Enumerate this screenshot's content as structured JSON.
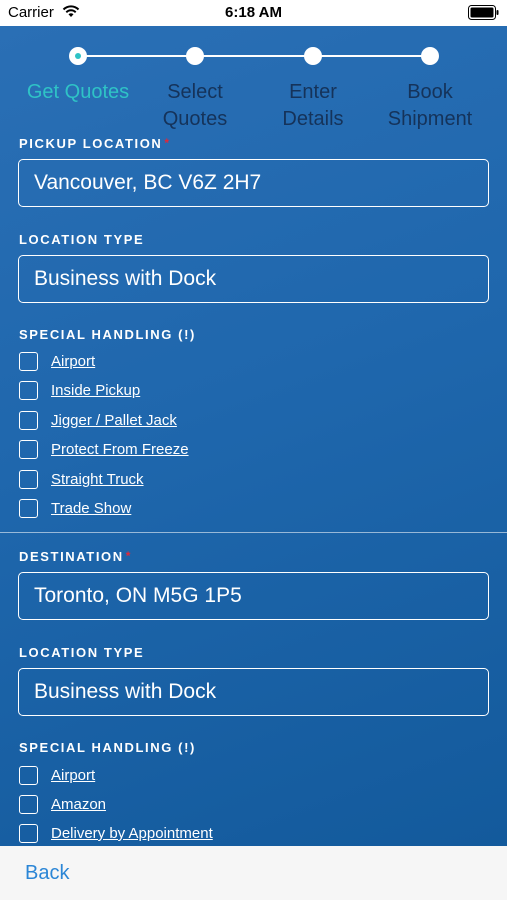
{
  "status_bar": {
    "carrier": "Carrier",
    "time": "6:18 AM"
  },
  "stepper": {
    "steps": [
      {
        "label_line1": "Get Quotes",
        "label_line2": ""
      },
      {
        "label_line1": "Select",
        "label_line2": "Quotes"
      },
      {
        "label_line1": "Enter",
        "label_line2": "Details"
      },
      {
        "label_line1": "Book",
        "label_line2": "Shipment"
      }
    ]
  },
  "pickup": {
    "label": "PICKUP LOCATION",
    "required_mark": "*",
    "value": "Vancouver, BC V6Z 2H7",
    "location_type_label": "LOCATION TYPE",
    "location_type_value": "Business with Dock",
    "special_handling_label": "SPECIAL HANDLING (!)",
    "options": [
      "Airport",
      "Inside Pickup",
      "Jigger / Pallet Jack",
      "Protect From Freeze",
      "Straight Truck",
      "Trade Show"
    ]
  },
  "destination": {
    "label": "DESTINATION",
    "required_mark": "*",
    "value": "Toronto, ON M5G 1P5",
    "location_type_label": "LOCATION TYPE",
    "location_type_value": "Business with Dock",
    "special_handling_label": "SPECIAL HANDLING (!)",
    "options": [
      "Airport",
      "Amazon",
      "Delivery by Appointment"
    ]
  },
  "footer": {
    "back_label": "Back"
  },
  "colors": {
    "accent": "#2fc3c6",
    "required": "#e0283a",
    "link": "#2b86d6"
  }
}
